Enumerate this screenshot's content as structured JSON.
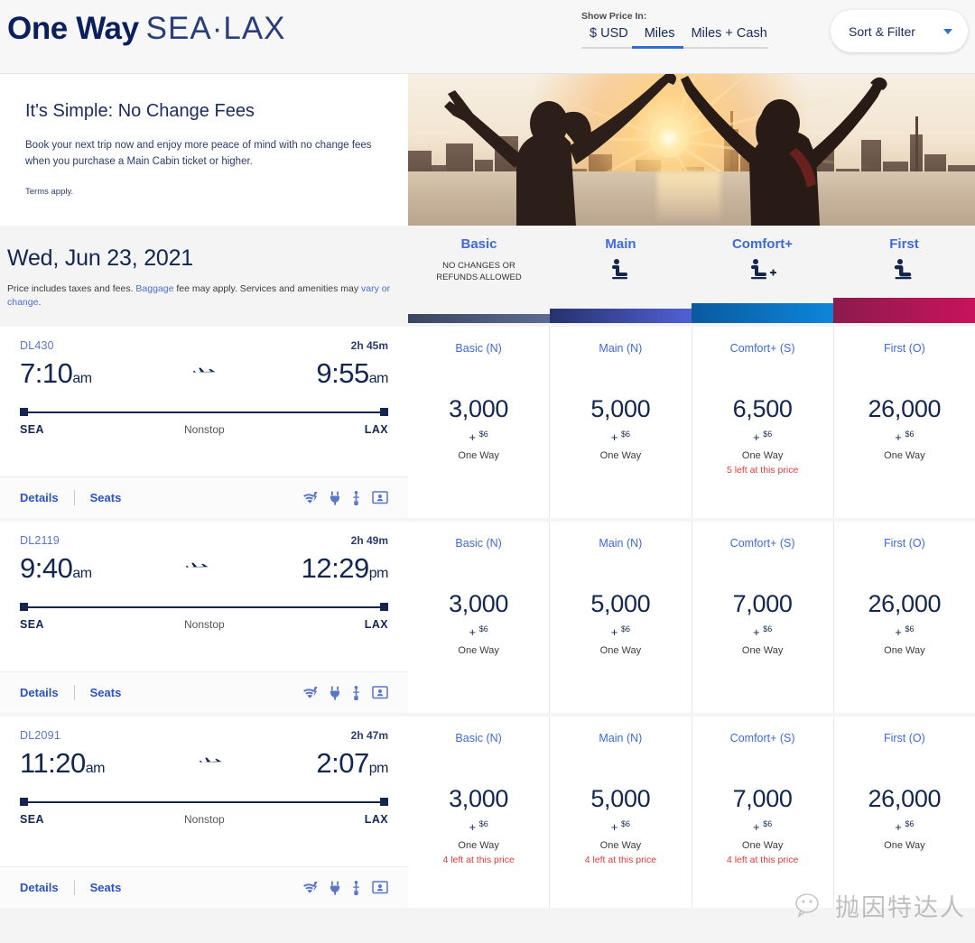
{
  "header": {
    "trip_type": "One Way",
    "route": "SEA·LAX",
    "price_toggle_label": "Show Price In:",
    "tabs": [
      {
        "label": "$ USD",
        "active": false
      },
      {
        "label": "Miles",
        "active": true
      },
      {
        "label": "Miles + Cash",
        "active": false
      }
    ],
    "sort_filter_label": "Sort & Filter"
  },
  "promo": {
    "title": "It's Simple: No Change Fees",
    "body": "Book your next trip now and enjoy more peace of mind with no change fees when you purchase a Main Cabin ticket or higher.",
    "terms": "Terms apply."
  },
  "date_section": {
    "date": "Wed, Jun 23, 2021",
    "note_part1": "Price includes taxes and fees. ",
    "note_link1": "Baggage",
    "note_part2": " fee may apply. Services and amenities may ",
    "note_link2": "vary or change",
    "note_part3": "."
  },
  "fare_columns": [
    {
      "name": "Basic",
      "subtitle": "NO CHANGES OR REFUNDS ALLOWED",
      "icon": "",
      "bar_class": "bar-basic",
      "bar_color": "#39465f"
    },
    {
      "name": "Main",
      "subtitle": "",
      "icon": "seat-icon",
      "bar_class": "bar-main",
      "bar_color": "#27326e"
    },
    {
      "name": "Comfort+",
      "subtitle": "",
      "icon": "seat-plus-icon",
      "bar_class": "bar-comfort",
      "bar_color": "#0a5a9e"
    },
    {
      "name": "First",
      "subtitle": "",
      "icon": "seat-first-icon",
      "bar_class": "bar-first",
      "bar_color": "#8c1b4c"
    }
  ],
  "flights": [
    {
      "flight_number": "DL430",
      "duration": "2h 45m",
      "depart_time": "7:10",
      "depart_meridiem": "am",
      "arrive_time": "9:55",
      "arrive_meridiem": "am",
      "origin": "SEA",
      "destination": "LAX",
      "stops": "Nonstop",
      "details_label": "Details",
      "seats_label": "Seats",
      "amenities": [
        "wifi-icon",
        "power-icon",
        "usb-icon",
        "entertainment-icon"
      ],
      "fares": [
        {
          "name": "Basic (N)",
          "miles": "3,000",
          "plus": "$6",
          "term": "One Way",
          "left": ""
        },
        {
          "name": "Main (N)",
          "miles": "5,000",
          "plus": "$6",
          "term": "One Way",
          "left": ""
        },
        {
          "name": "Comfort+ (S)",
          "miles": "6,500",
          "plus": "$6",
          "term": "One Way",
          "left": "5 left at this price"
        },
        {
          "name": "First (O)",
          "miles": "26,000",
          "plus": "$6",
          "term": "One Way",
          "left": ""
        }
      ]
    },
    {
      "flight_number": "DL2119",
      "duration": "2h 49m",
      "depart_time": "9:40",
      "depart_meridiem": "am",
      "arrive_time": "12:29",
      "arrive_meridiem": "pm",
      "origin": "SEA",
      "destination": "LAX",
      "stops": "Nonstop",
      "details_label": "Details",
      "seats_label": "Seats",
      "amenities": [
        "wifi-icon",
        "power-icon",
        "usb-icon",
        "entertainment-icon"
      ],
      "fares": [
        {
          "name": "Basic (N)",
          "miles": "3,000",
          "plus": "$6",
          "term": "One Way",
          "left": ""
        },
        {
          "name": "Main (N)",
          "miles": "5,000",
          "plus": "$6",
          "term": "One Way",
          "left": ""
        },
        {
          "name": "Comfort+ (S)",
          "miles": "7,000",
          "plus": "$6",
          "term": "One Way",
          "left": ""
        },
        {
          "name": "First (O)",
          "miles": "26,000",
          "plus": "$6",
          "term": "One Way",
          "left": ""
        }
      ]
    },
    {
      "flight_number": "DL2091",
      "duration": "2h 47m",
      "depart_time": "11:20",
      "depart_meridiem": "am",
      "arrive_time": "2:07",
      "arrive_meridiem": "pm",
      "origin": "SEA",
      "destination": "LAX",
      "stops": "Nonstop",
      "details_label": "Details",
      "seats_label": "Seats",
      "amenities": [
        "wifi-icon",
        "power-icon",
        "usb-icon",
        "entertainment-icon"
      ],
      "fares": [
        {
          "name": "Basic (N)",
          "miles": "3,000",
          "plus": "$6",
          "term": "One Way",
          "left": "4 left at this price"
        },
        {
          "name": "Main (N)",
          "miles": "5,000",
          "plus": "$6",
          "term": "One Way",
          "left": "4 left at this price"
        },
        {
          "name": "Comfort+ (S)",
          "miles": "7,000",
          "plus": "$6",
          "term": "One Way",
          "left": "4 left at this price"
        },
        {
          "name": "First (O)",
          "miles": "26,000",
          "plus": "$6",
          "term": "One Way",
          "left": ""
        }
      ]
    }
  ],
  "watermark": {
    "text": "抛因特达人"
  },
  "colors": {
    "brand_navy": "#12264f",
    "accent_blue": "#3e6ad6",
    "alert_red": "#e23b3b"
  }
}
